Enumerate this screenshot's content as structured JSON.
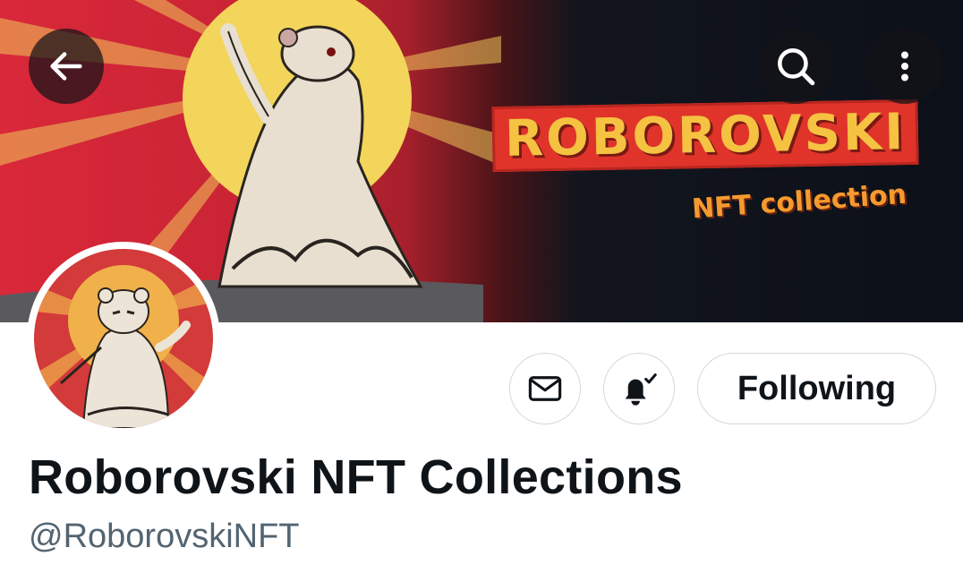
{
  "banner": {
    "title": "ROBOROVSKI",
    "subtitle": "NFT collection",
    "colors": {
      "red": "#d9283a",
      "sun": "#f2d55a",
      "dark": "#0c1018",
      "title_gold": "#f5c242",
      "subtitle_orange": "#f59a2e"
    }
  },
  "toolbar": {
    "back_icon": "arrow-left-icon",
    "search_icon": "search-icon",
    "more_icon": "more-vertical-icon"
  },
  "profile": {
    "display_name": "Roborovski NFT Collections",
    "handle": "@RoborovskiNFT",
    "avatar_icon": "hamster-avatar"
  },
  "actions": {
    "message_icon": "mail-icon",
    "notify_icon": "bell-check-icon",
    "following_label": "Following"
  }
}
